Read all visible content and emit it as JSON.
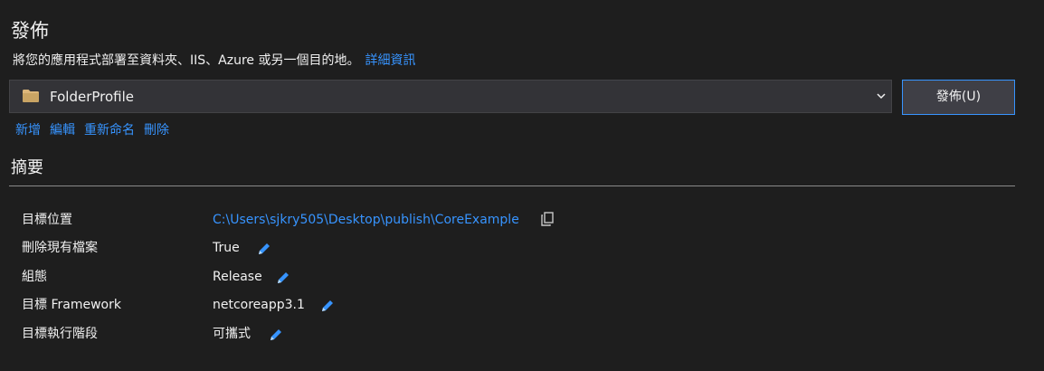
{
  "header": {
    "title": "發佈",
    "description": "將您的應用程式部署至資料夾、IIS、Azure 或另一個目的地。",
    "more_info_link": "詳細資訊"
  },
  "profile": {
    "selected": "FolderProfile",
    "icon": "folder-icon",
    "publish_button": "發佈(U)"
  },
  "actions": {
    "new": "新增",
    "edit": "編輯",
    "rename": "重新命名",
    "delete": "刪除"
  },
  "summary": {
    "title": "摘要",
    "rows": [
      {
        "label": "目標位置",
        "value": "C:\\Users\\sjkry505\\Desktop\\publish\\CoreExample",
        "action_icon": "copy-icon"
      },
      {
        "label": "刪除現有檔案",
        "value": "True",
        "action_icon": "edit-icon"
      },
      {
        "label": "組態",
        "value": "Release",
        "action_icon": "edit-icon"
      },
      {
        "label": "目標 Framework",
        "value": "netcoreapp3.1",
        "action_icon": "edit-icon"
      },
      {
        "label": "目標執行階段",
        "value": "可攜式",
        "action_icon": "edit-icon"
      }
    ]
  },
  "colors": {
    "background": "#1e1e1e",
    "link": "#3794ff",
    "input_background": "#333337",
    "button_border": "#3794ff",
    "folder_icon": "#dcb67a",
    "edit_icon": "#3794ff"
  }
}
